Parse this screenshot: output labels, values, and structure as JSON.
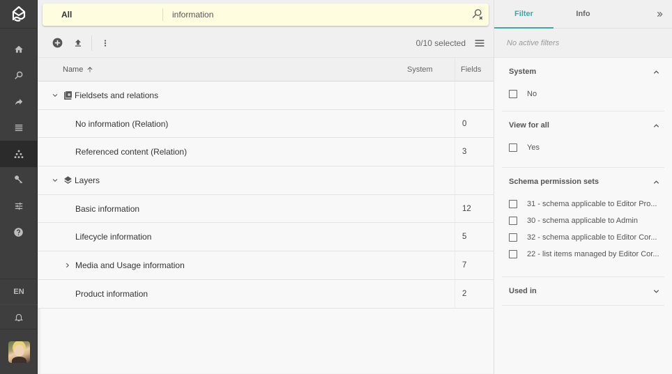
{
  "nav": {
    "logo": "app-logo",
    "items": [
      {
        "name": "home",
        "icon": "home-icon",
        "active": false
      },
      {
        "name": "search",
        "icon": "search-icon",
        "active": false
      },
      {
        "name": "share",
        "icon": "share-icon",
        "active": false
      },
      {
        "name": "list",
        "icon": "list-icon",
        "active": false
      },
      {
        "name": "schema",
        "icon": "hierarchy-icon",
        "active": true
      },
      {
        "name": "permissions",
        "icon": "key-icon",
        "active": false
      },
      {
        "name": "settings",
        "icon": "tune-icon",
        "active": false
      },
      {
        "name": "help",
        "icon": "help-icon",
        "active": false
      }
    ],
    "language": "EN"
  },
  "search": {
    "scope": "All",
    "value": "information",
    "placeholder": ""
  },
  "toolbar": {
    "selected_text": "0/10 selected"
  },
  "table": {
    "columns": {
      "name": "Name",
      "system": "System",
      "fields": "Fields"
    },
    "sort": {
      "column": "Name",
      "direction": "ascending"
    },
    "groups": [
      {
        "label": "Fieldsets and relations",
        "icon": "fieldset-icon",
        "expanded": true,
        "rows": [
          {
            "name": "No information (Relation)",
            "system": "",
            "fields": "0",
            "expandable": false
          },
          {
            "name": "Referenced content (Relation)",
            "system": "",
            "fields": "3",
            "expandable": false
          }
        ]
      },
      {
        "label": "Layers",
        "icon": "layers-icon",
        "expanded": true,
        "rows": [
          {
            "name": "Basic information",
            "system": "",
            "fields": "12",
            "expandable": false
          },
          {
            "name": "Lifecycle information",
            "system": "",
            "fields": "5",
            "expandable": false
          },
          {
            "name": "Media and Usage information",
            "system": "",
            "fields": "7",
            "expandable": true
          },
          {
            "name": "Product information",
            "system": "",
            "fields": "2",
            "expandable": false
          }
        ]
      }
    ]
  },
  "panel": {
    "tabs": [
      {
        "label": "Filter",
        "active": true
      },
      {
        "label": "Info",
        "active": false
      }
    ],
    "no_filters": "No active filters",
    "sections": [
      {
        "title": "System",
        "expanded": true,
        "options": [
          {
            "label": "No",
            "checked": false
          }
        ]
      },
      {
        "title": "View for all",
        "expanded": true,
        "options": [
          {
            "label": "Yes",
            "checked": false
          }
        ]
      },
      {
        "title": "Schema permission sets",
        "expanded": true,
        "options": [
          {
            "label": "31 - schema applicable to Editor Pro...",
            "checked": false
          },
          {
            "label": "30 - schema applicable to Admin",
            "checked": false
          },
          {
            "label": "32 - schema applicable to Editor Cor...",
            "checked": false
          },
          {
            "label": "22 - list items managed by Editor Cor...",
            "checked": false
          }
        ]
      },
      {
        "title": "Used in",
        "expanded": false,
        "options": []
      }
    ]
  },
  "colors": {
    "accent": "#3aa9a6",
    "nav_bg": "#3e3e3e",
    "nav_active": "#2b2b2b",
    "search_bg": "#fefde0"
  }
}
